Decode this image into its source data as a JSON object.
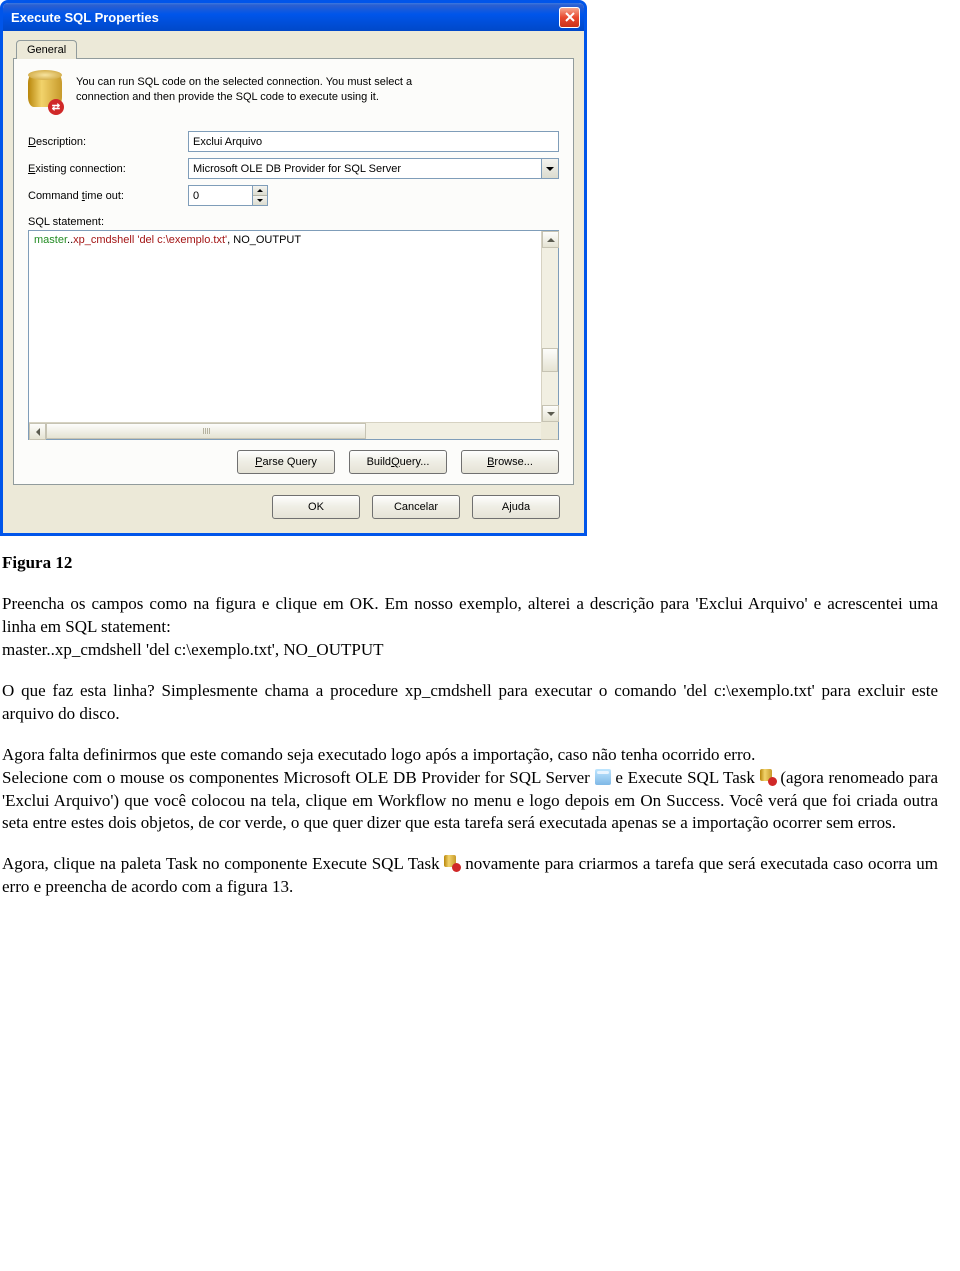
{
  "dialog": {
    "title": "Execute SQL Properties",
    "tab": "General",
    "intro": "You can run SQL code on the selected connection. You must select a connection and then provide the SQL code to execute using it.",
    "labels": {
      "description": "Description:",
      "existing_connection": "Existing connection:",
      "command_timeout": "Command time out:",
      "sql_statement": "SQL statement:"
    },
    "fields": {
      "description": "Exclui Arquivo",
      "existing_connection": "Microsoft OLE DB Provider for SQL Server",
      "command_timeout": "0"
    },
    "sql": {
      "db": "master",
      "dots": "..",
      "proc": "xp_cmdshell",
      "arg": " 'del c:\\exemplo.txt'",
      "tail": ", NO_OUTPUT"
    },
    "buttons": {
      "parse": "Parse Query",
      "build": "Build Query...",
      "browse": "Browse...",
      "ok": "OK",
      "cancel": "Cancelar",
      "help": "Ajuda"
    }
  },
  "doc": {
    "figure": "Figura 12",
    "p1": "Preencha os campos como na figura e clique em OK. Em nosso exemplo, alterei a descrição para 'Exclui Arquivo' e acrescentei uma linha em SQL statement:",
    "p1b": "master..xp_cmdshell 'del c:\\exemplo.txt', NO_OUTPUT",
    "p2": "O que faz esta linha? Simplesmente chama a procedure xp_cmdshell para executar o comando 'del c:\\exemplo.txt' para excluir este arquivo do disco.",
    "p3a": "Agora falta definirmos que este comando seja executado logo após a importação, caso não tenha ocorrido erro.",
    "p3b_pre": "Selecione com o mouse os componentes Microsoft OLE DB Provider for SQL Server ",
    "p3b_mid": " e Execute SQL Task ",
    "p3b_post": " (agora renomeado para 'Exclui Arquivo') que você colocou na tela, clique em Workflow no menu e logo depois em On Success. Você verá que foi criada outra seta entre estes dois objetos, de cor verde, o que quer dizer que esta tarefa será executada apenas se a importação ocorrer sem erros.",
    "p4_pre": "Agora, clique na paleta Task no componente Execute SQL Task ",
    "p4_post": " novamente para criarmos a tarefa que será executada caso ocorra um erro e preencha de acordo com a figura 13."
  }
}
